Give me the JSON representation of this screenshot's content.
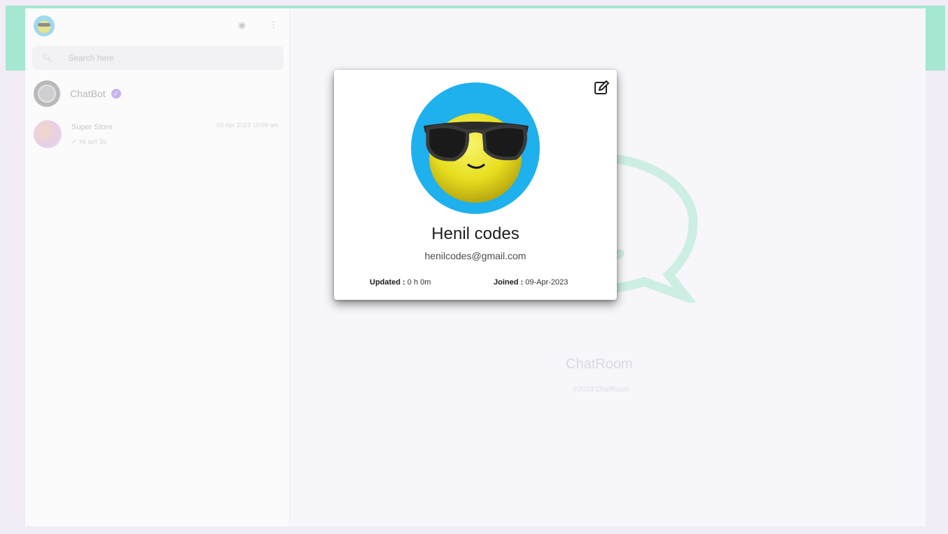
{
  "sidebar": {
    "search": {
      "placeholder": "Search here"
    },
    "chats": [
      {
        "name": "ChatBot",
        "verified": true
      },
      {
        "name": "Super Store",
        "last_message": "✓ Hi set 3s",
        "time": "09 Apr 2023 10:09 am"
      }
    ]
  },
  "main": {
    "title": "ChatRoom",
    "credit": "©2023 ChatRoom"
  },
  "profile": {
    "name": "Henil codes",
    "email": "henilcodes@gmail.com",
    "updated_label": "Updated :",
    "updated_value": " 0 h 0m",
    "joined_label": "Joined :",
    "joined_value": " 09-Apr-2023"
  },
  "colors": {
    "accent_band": "#a5e7d0",
    "background": "#f1ecf6",
    "avatar_bg": "#1fb0ee",
    "verified": "#c8b3ec"
  },
  "icons": {
    "header_left": "user-avatar",
    "header_right": [
      "status-icon",
      "more-icon"
    ],
    "search": "search-icon",
    "edit": "edit-icon"
  }
}
